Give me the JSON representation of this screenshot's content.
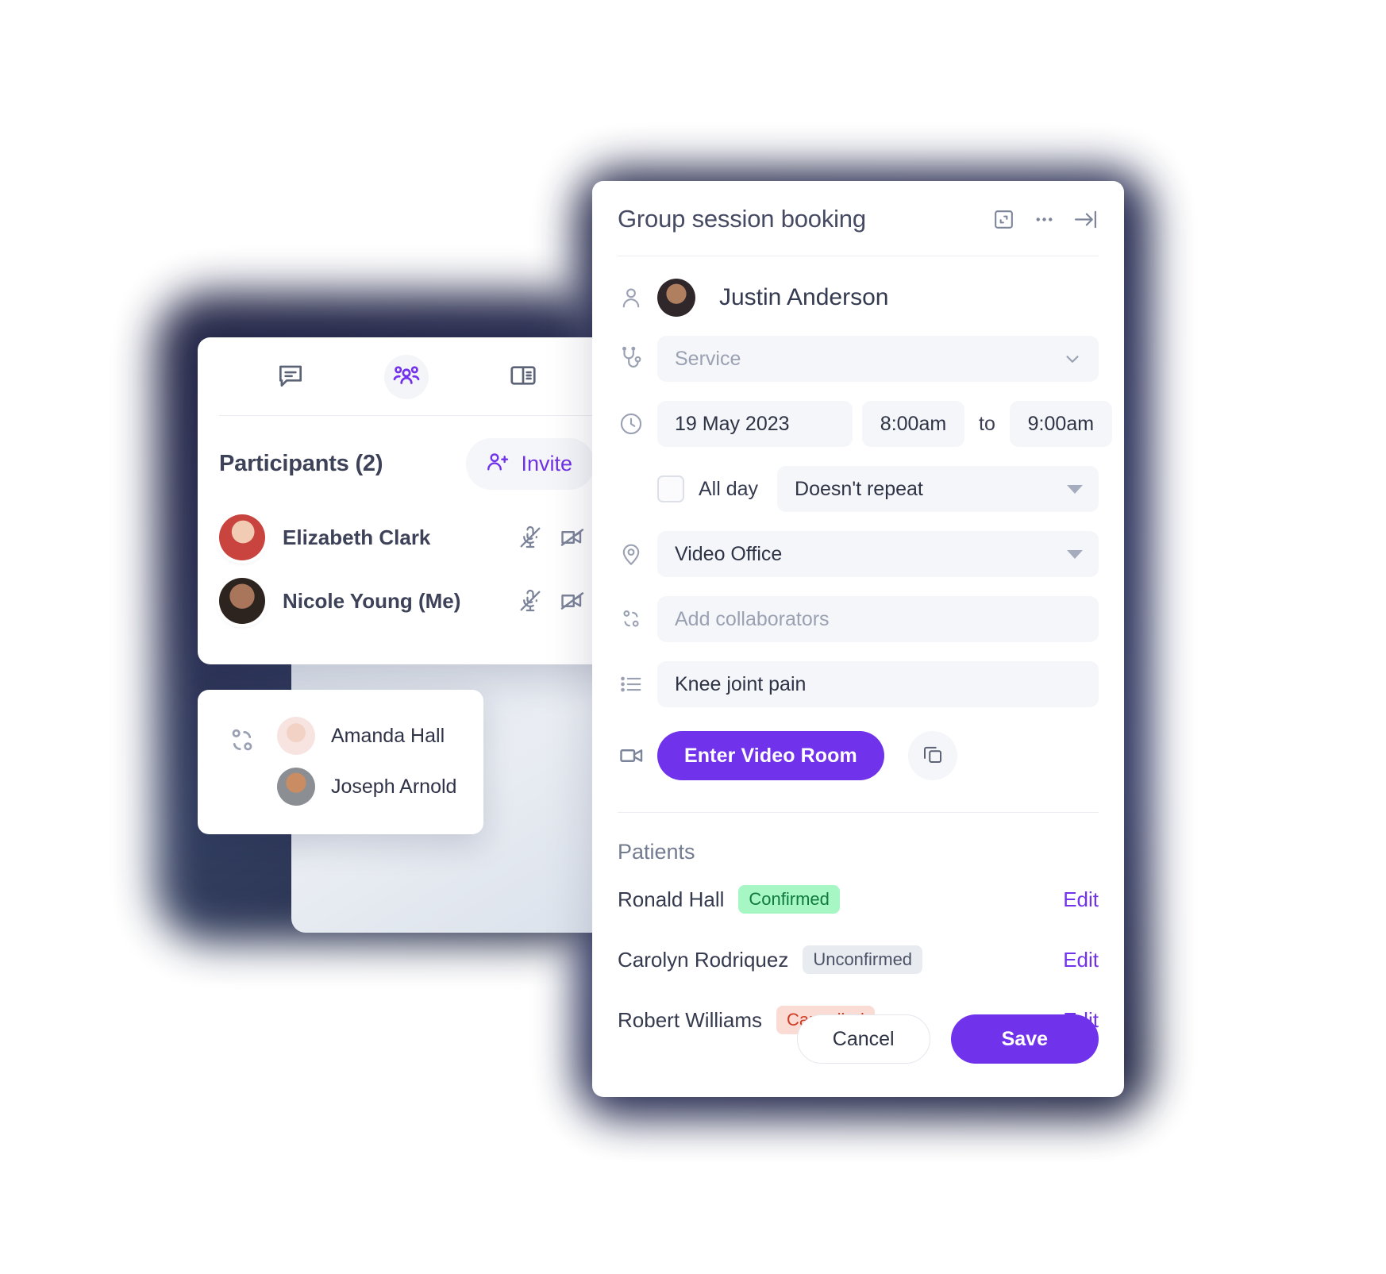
{
  "video_panel": {
    "tabs": [
      {
        "id": "chat",
        "icon": "chat-bubble-icon",
        "active": false
      },
      {
        "id": "participants",
        "icon": "people-group-icon",
        "active": true
      },
      {
        "id": "notes",
        "icon": "book-panel-icon",
        "active": false
      }
    ],
    "participants_heading": "Participants (2)",
    "invite_label": "Invite",
    "invite_icon": "user-plus-icon",
    "participants": [
      {
        "name": "Elizabeth Clark",
        "avatar": "face-a",
        "mic_icon": "mic-off-icon",
        "camera_icon": "camera-off-icon"
      },
      {
        "name": "Nicole Young (Me)",
        "avatar": "face-b",
        "mic_icon": "mic-off-icon",
        "camera_icon": "camera-off-icon"
      }
    ]
  },
  "collaborators_card": {
    "icon": "collaborators-icon",
    "people": [
      {
        "name": "Amanda Hall",
        "avatar": "face-c"
      },
      {
        "name": "Joseph Arnold",
        "avatar": "face-d"
      }
    ]
  },
  "booking": {
    "title": "Group session booking",
    "header_icons": [
      {
        "id": "expand",
        "icon": "expand-panel-icon"
      },
      {
        "id": "more",
        "icon": "more-horizontal-icon"
      },
      {
        "id": "collapse",
        "icon": "arrow-right-to-line-icon"
      }
    ],
    "owner": {
      "icon": "person-icon",
      "name": "Justin Anderson",
      "avatar": "face-e"
    },
    "service": {
      "icon": "stethoscope-icon",
      "value": "",
      "placeholder": "Service",
      "chevron": "chevron-down-icon"
    },
    "schedule": {
      "icon": "clock-icon",
      "date": "19 May 2023",
      "start_time": "8:00am",
      "separator": "to",
      "end_time": "9:00am"
    },
    "all_day": {
      "label": "All day",
      "checked": false
    },
    "repeat": {
      "value": "Doesn't repeat",
      "chevron": "triangle-down-icon"
    },
    "location": {
      "icon": "map-pin-icon",
      "value": "Video Office",
      "chevron": "triangle-down-icon"
    },
    "collaborators": {
      "icon": "collaborators-icon",
      "value": "",
      "placeholder": "Add collaborators"
    },
    "reason": {
      "icon": "list-icon",
      "value": "Knee joint pain"
    },
    "video_room": {
      "icon": "video-camera-icon",
      "button_label": "Enter Video Room",
      "copy_icon": "copy-icon"
    },
    "patients_section": {
      "title": "Patients",
      "rows": [
        {
          "name": "Ronald Hall",
          "status": "Confirmed",
          "status_kind": "confirmed",
          "action": "Edit"
        },
        {
          "name": "Carolyn Rodriquez",
          "status": "Unconfirmed",
          "status_kind": "unconfirmed",
          "action": "Edit"
        },
        {
          "name": "Robert Williams",
          "status": "Cancelled",
          "status_kind": "cancelled",
          "action": "Edit"
        }
      ]
    },
    "footer": {
      "cancel_label": "Cancel",
      "save_label": "Save"
    }
  },
  "colors": {
    "accent": "#7132ec",
    "confirmed_bg": "#a6f7c4",
    "confirmed_fg": "#107a3e",
    "unconfirmed_bg": "#e8ebf0",
    "unconfirmed_fg": "#4b5266",
    "cancelled_bg": "#fbdcd5",
    "cancelled_fg": "#d13a22",
    "field_bg": "#f5f6f9",
    "text": "#343a4f"
  }
}
